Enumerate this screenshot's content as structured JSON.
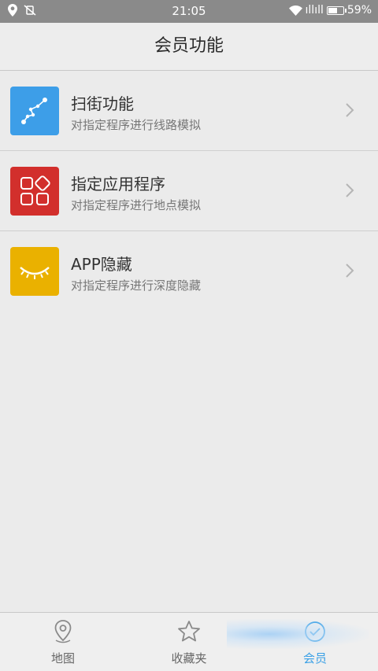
{
  "status_bar": {
    "time": "21:05",
    "signal_text": "ıllıll",
    "battery_percent": "59%",
    "battery_level": 0.59
  },
  "header": {
    "title": "会员功能"
  },
  "features": [
    {
      "title": "扫街功能",
      "subtitle": "对指定程序进行线路模拟",
      "icon": "route-icon",
      "color": "#3d9ee8"
    },
    {
      "title": "指定应用程序",
      "subtitle": "对指定程序进行地点模拟",
      "icon": "apps-grid-icon",
      "color": "#d22f2c"
    },
    {
      "title": "APP隐藏",
      "subtitle": "对指定程序进行深度隐藏",
      "icon": "closed-eye-icon",
      "color": "#eab100"
    }
  ],
  "tabs": [
    {
      "label": "地图",
      "icon": "map-pin-icon",
      "active": false
    },
    {
      "label": "收藏夹",
      "icon": "star-icon",
      "active": false
    },
    {
      "label": "会员",
      "icon": "member-icon",
      "active": true
    }
  ],
  "colors": {
    "accent": "#3aa0e6",
    "status_bar": "#8a8a8a",
    "background": "#ebebeb"
  }
}
